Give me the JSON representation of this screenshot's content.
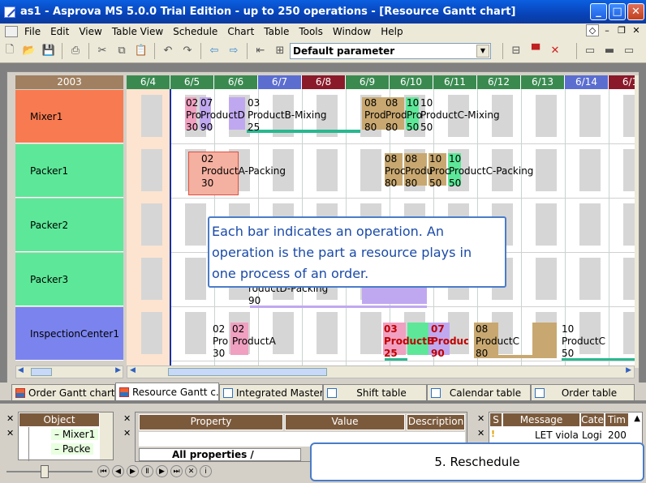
{
  "window": {
    "title": "as1 - Asprova MS 5.0.0 Trial Edition  - up to 250 operations - [Resource Gantt chart]"
  },
  "menu": [
    "File",
    "Edit",
    "View",
    "Table View",
    "Schedule",
    "Chart",
    "Table",
    "Tools",
    "Window",
    "Help"
  ],
  "toolbar": {
    "parameter_combo": "Default parameter"
  },
  "gantt": {
    "year": "2003",
    "dates": [
      "6/4",
      "6/5",
      "6/6",
      "6/7",
      "6/8",
      "6/9",
      "6/10",
      "6/11",
      "6/12",
      "6/13",
      "6/14",
      "6/1"
    ],
    "date_colors": [
      "#3a8a50",
      "#3a8a50",
      "#3a8a50",
      "#5b6ed0",
      "#8a1a2a",
      "#3a8a50",
      "#3a8a50",
      "#3a8a50",
      "#3a8a50",
      "#3a8a50",
      "#5b6ed0",
      "#8a1a2a"
    ],
    "resources": [
      {
        "name": "Mixer1",
        "color": "#f87a50"
      },
      {
        "name": "Packer1",
        "color": "#5ce898"
      },
      {
        "name": "Packer2",
        "color": "#5ce898"
      },
      {
        "name": "Packer3",
        "color": "#5ce898"
      },
      {
        "name": "InspectionCenter1",
        "color": "#7b84ee"
      }
    ],
    "labels": {
      "m_a1": "02",
      "m_a2": "Pro",
      "m_a3": "30",
      "m_b1": "07",
      "m_b2": "ProductD",
      "m_b3": "90",
      "m_c1": "03",
      "m_c2": "ProductB-Mixing",
      "m_c3": "25",
      "m_d1": "08",
      "m_d2": "Prod",
      "m_d3": "80",
      "m_e1": "08",
      "m_e2": "Prod",
      "m_e3": "80",
      "m_f1": "10",
      "m_f2": "Pro",
      "m_f3": "50",
      "m_g1": "10",
      "m_g2": "ProductC-Mixing",
      "m_g3": "50",
      "p1_a1": "02",
      "p1_a2": "ProductA-Packing",
      "p1_a3": "30",
      "p1_b1": "08",
      "p1_b2": "Proc",
      "p1_b3": "80",
      "p1_c1": "08",
      "p1_c2": "Produ",
      "p1_c3": "80",
      "p1_d1": "10",
      "p1_d2": "Proc",
      "p1_d3": "50",
      "p1_e1": "10",
      "p1_e2": "ProductC-Packing",
      "p1_e3": "50",
      "p3_a1": "roductD-Packing",
      "p3_a2": "90",
      "ic_a1": "02",
      "ic_a2": "Pro",
      "ic_a3": "30",
      "ic_b1": "02",
      "ic_b2": "ProductA",
      "ic_c1": "03",
      "ic_c2": "ProductB",
      "ic_c3": "25",
      "ic_d1": "07",
      "ic_d2": "ProductI",
      "ic_d3": "90",
      "ic_e1": "08",
      "ic_e2": "ProductC",
      "ic_e3": "80",
      "ic_f1": "10",
      "ic_f2": "ProductC",
      "ic_f3": "50"
    },
    "tooltip": [
      "Each bar indicates an operation. An",
      "operation is the part a resource plays in",
      "one process of an order."
    ]
  },
  "tabs": [
    "Order Gantt chart",
    "Resource Gantt c...",
    "Integrated Master...",
    "Shift table",
    "Calendar table",
    "Order table"
  ],
  "object_pane": {
    "header": "Object",
    "items": [
      "Mixer1",
      "Packe"
    ]
  },
  "property_pane": {
    "columns": [
      "Property",
      "Value",
      "Description"
    ],
    "tab": "All properties /"
  },
  "message_pane": {
    "columns": [
      "S",
      "Message",
      "Cate",
      "Tim"
    ],
    "row": {
      "message": "LET viola",
      "cate": "Logi",
      "time": "200"
    }
  },
  "step_box": "5. Reschedule"
}
